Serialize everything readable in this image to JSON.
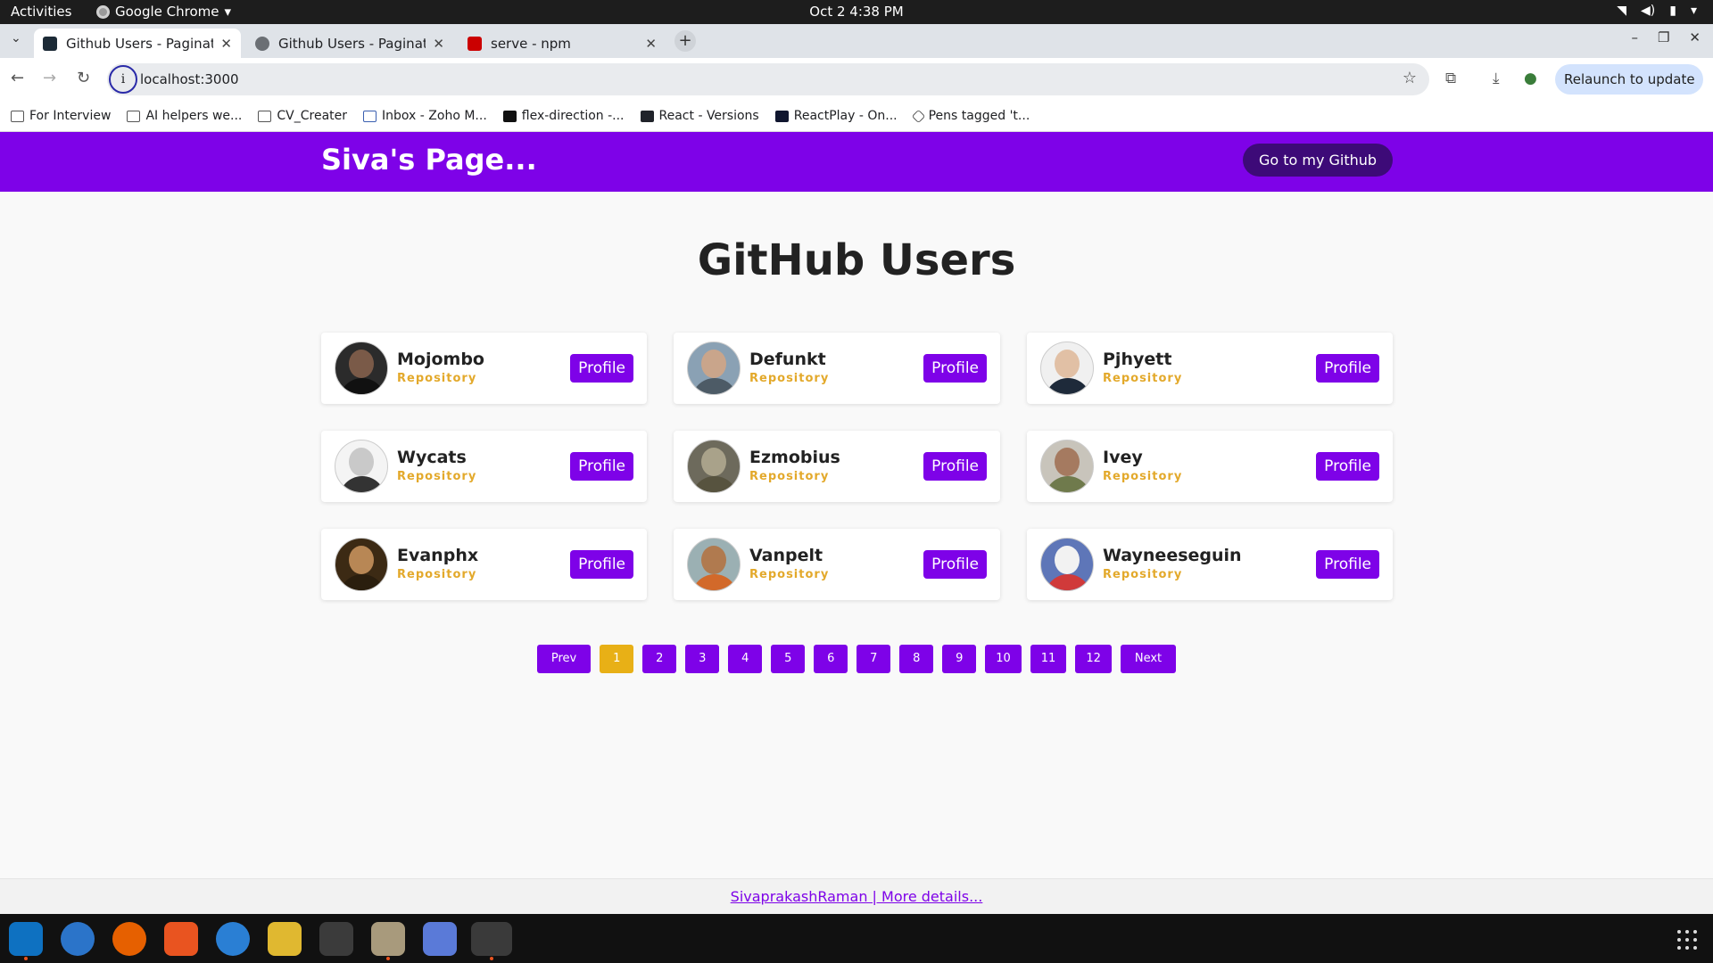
{
  "system": {
    "activities": "Activities",
    "app_name": "Google Chrome",
    "datetime": "Oct 2  4:38 PM"
  },
  "browser": {
    "tabs": [
      {
        "label": "Github Users - Pagination",
        "active": true
      },
      {
        "label": "Github Users - Pagination",
        "active": false
      },
      {
        "label": "serve - npm",
        "active": false
      }
    ],
    "url": "localhost:3000",
    "relaunch_label": "Relaunch to update",
    "bookmarks": [
      {
        "label": "For Interview",
        "icon": "folder-icon"
      },
      {
        "label": "AI helpers we...",
        "icon": "folder-icon"
      },
      {
        "label": "CV_Creater",
        "icon": "folder-icon"
      },
      {
        "label": "Inbox - Zoho M...",
        "icon": "zoho-mail-icon"
      },
      {
        "label": "flex-direction -...",
        "icon": "mdn-icon"
      },
      {
        "label": "React - Versions",
        "icon": "react-icon"
      },
      {
        "label": "ReactPlay - On...",
        "icon": "reactplay-icon"
      },
      {
        "label": "Pens tagged 't...",
        "icon": "codepen-icon"
      }
    ]
  },
  "page": {
    "brand": "Siva's Page...",
    "github_button": "Go to my Github",
    "heading": "GitHub Users",
    "repo_label": "Repository",
    "profile_label": "Profile",
    "users": [
      {
        "name": "Mojombo"
      },
      {
        "name": "Defunkt"
      },
      {
        "name": "Pjhyett"
      },
      {
        "name": "Wycats"
      },
      {
        "name": "Ezmobius"
      },
      {
        "name": "Ivey"
      },
      {
        "name": "Evanphx"
      },
      {
        "name": "Vanpelt"
      },
      {
        "name": "Wayneeseguin"
      }
    ],
    "pagination": {
      "prev": "Prev",
      "next": "Next",
      "pages": [
        "1",
        "2",
        "3",
        "4",
        "5",
        "6",
        "7",
        "8",
        "9",
        "10",
        "11",
        "12"
      ],
      "current": "1"
    },
    "footer_link": "SivaprakashRaman | More details..."
  },
  "colors": {
    "accent": "#7e02e8",
    "current_page": "#e8b016",
    "repository_text": "#e3a92b"
  }
}
